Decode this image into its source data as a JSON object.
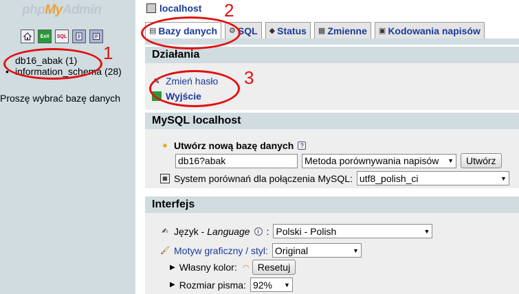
{
  "left": {
    "logo_php": "php",
    "logo_my": "My",
    "logo_admin": "Admin",
    "quick_icons": [
      "home-icon",
      "exit-icon",
      "sql-icon",
      "query-window-icon",
      "docs-icon"
    ],
    "quick_exit_label": "Exit",
    "quick_sql_label": "SQL",
    "databases": [
      {
        "label": "db16_abak (1)"
      },
      {
        "label": "information_schema (28)"
      }
    ],
    "choose_text": "Proszę wybrać bazę danych"
  },
  "right": {
    "server": "localhost",
    "tabs": [
      {
        "label": "Bazy danych",
        "icon": "databases-icon"
      },
      {
        "label": "SQL",
        "icon": "sql-icon"
      },
      {
        "label": "Status",
        "icon": "status-icon"
      },
      {
        "label": "Zmienne",
        "icon": "variables-icon"
      },
      {
        "label": "Kodowania napisów",
        "icon": "charsets-icon"
      }
    ],
    "actions": {
      "title": "Działania",
      "change_password": "Zmień hasło",
      "logout": "Wyjście"
    },
    "mysql": {
      "title": "MySQL localhost",
      "create_db_label": "Utwórz nową bazę danych",
      "db_name_value": "db16?abak",
      "collation_select": "Metoda porównywania napisów",
      "create_button": "Utwórz",
      "connection_collation_label": "System porównań dla połączenia MySQL:",
      "connection_collation_value": "utf8_polish_ci"
    },
    "interface": {
      "title": "Interfejs",
      "language_label_prefix": "Język - ",
      "language_label_italic": "Language",
      "language_value": "Polski - Polish",
      "theme_label": "Motyw graficzny / styl:",
      "theme_value": "Original",
      "custom_color_label": "Własny kolor:",
      "reset_button": "Resetuj",
      "font_size_label": "Rozmiar pisma:",
      "font_size_value": "92%"
    }
  },
  "annotations": [
    "1",
    "2",
    "3"
  ],
  "colors": {
    "annotation": "#e01010",
    "link": "#1a3a9a",
    "frame": "#d0dce0"
  }
}
